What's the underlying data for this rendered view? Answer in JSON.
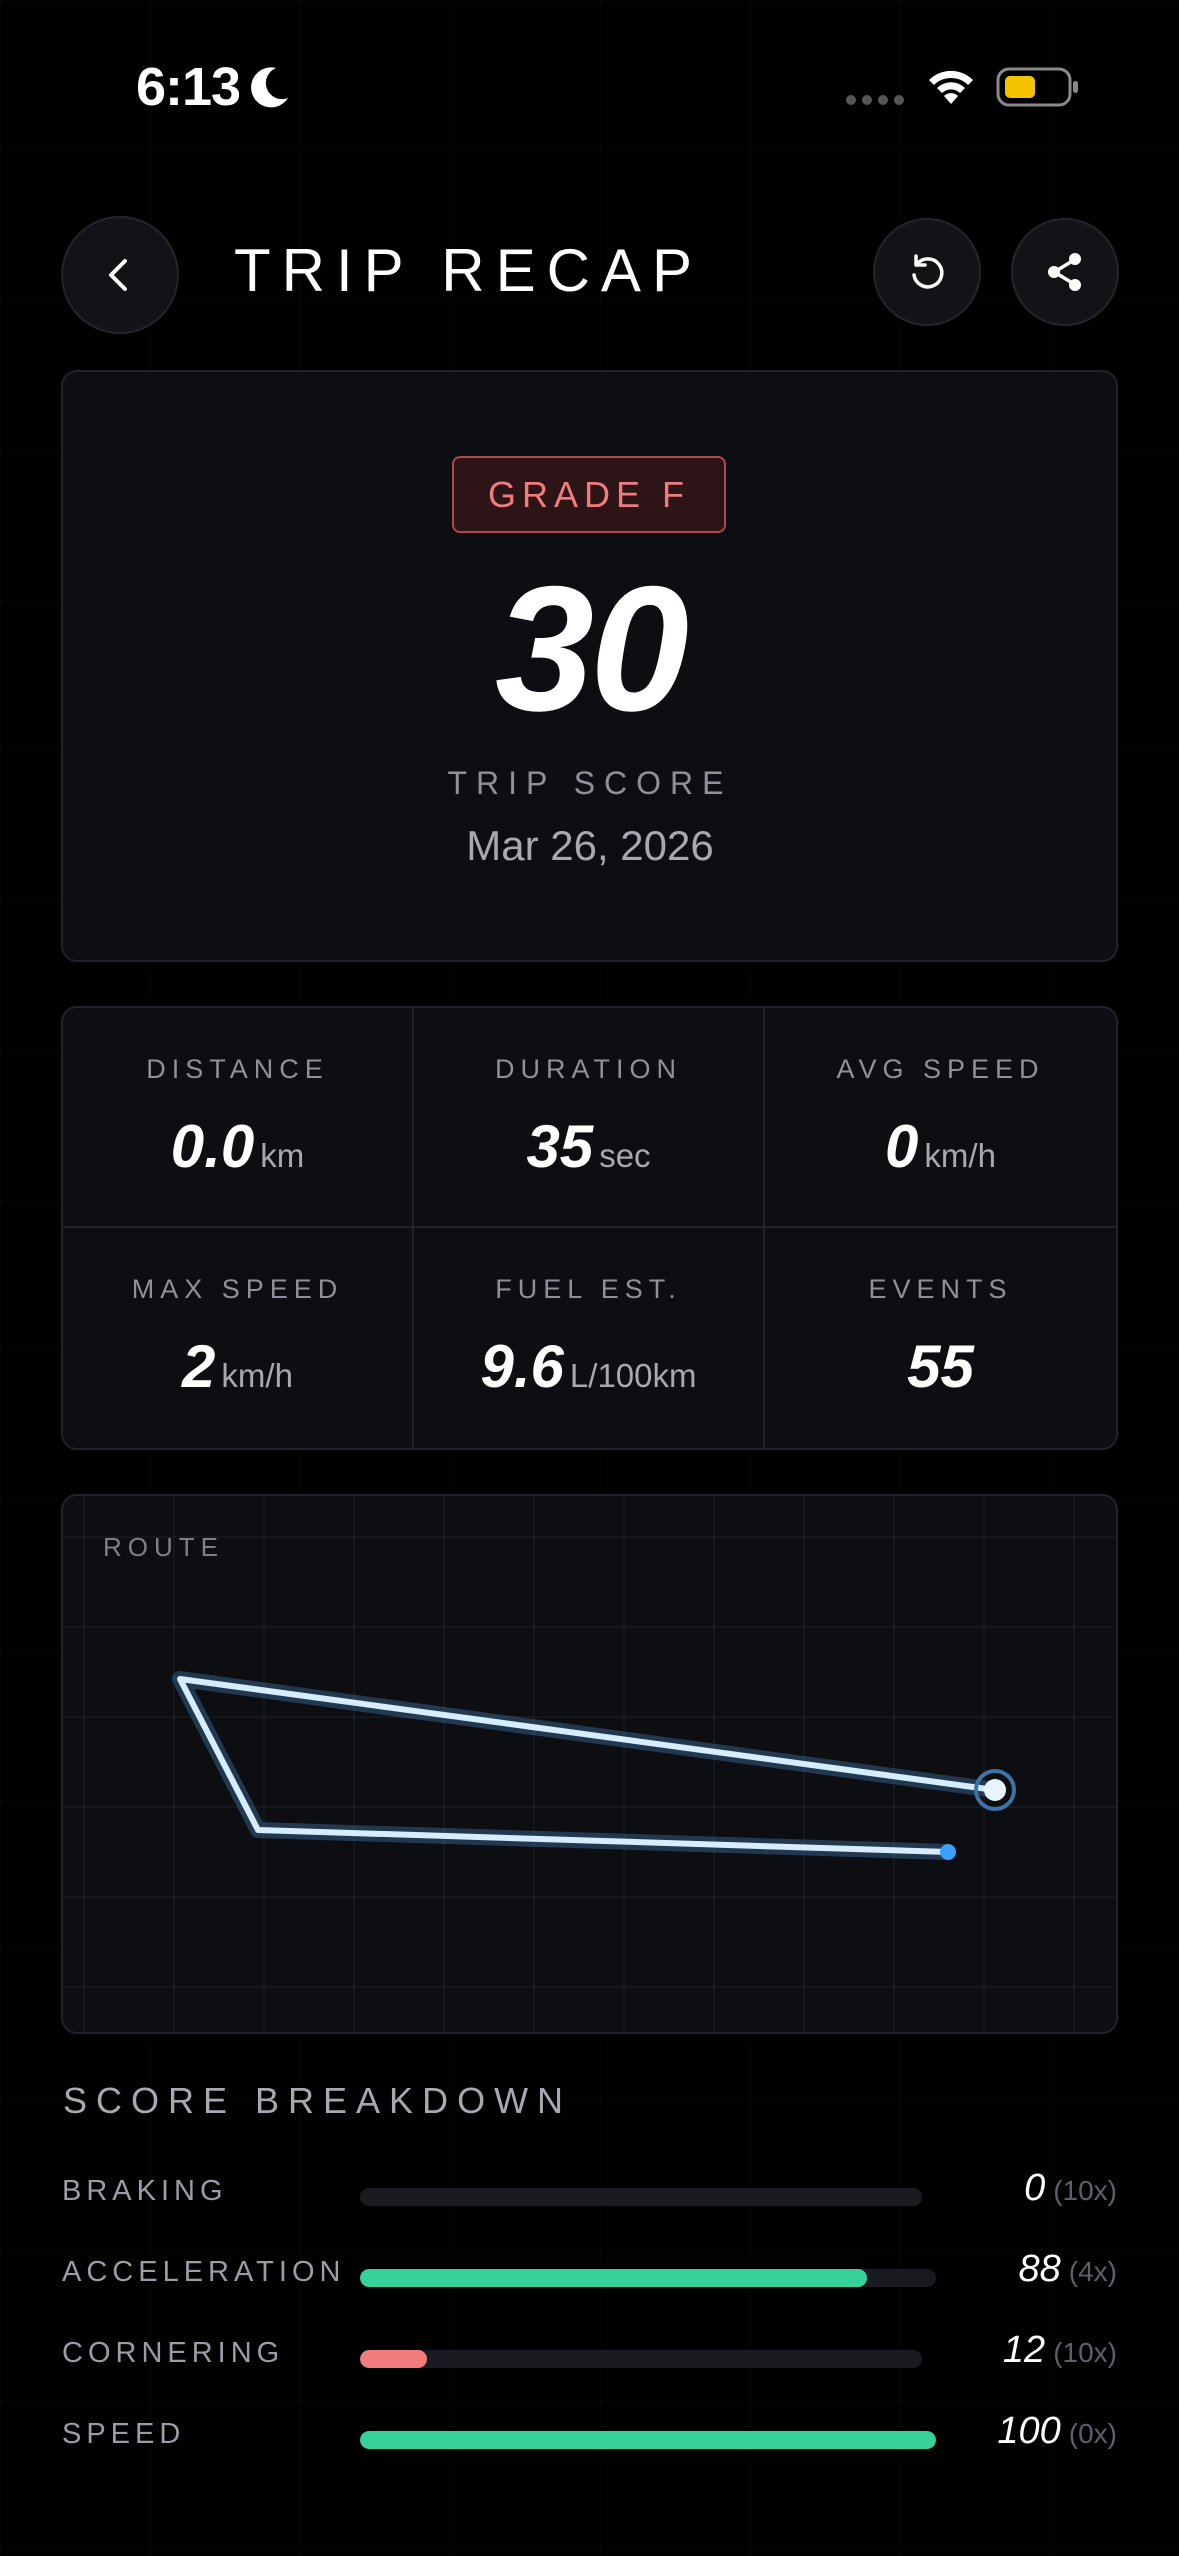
{
  "status_bar": {
    "time": "6:13",
    "battery_color": "#f5c400"
  },
  "header": {
    "title": "TRIP RECAP"
  },
  "score": {
    "grade": "GRADE F",
    "value": "30",
    "label": "TRIP SCORE",
    "date": "Mar 26, 2026"
  },
  "stats": [
    {
      "label": "DISTANCE",
      "value": "0.0",
      "unit": "km"
    },
    {
      "label": "DURATION",
      "value": "35",
      "unit": "sec"
    },
    {
      "label": "AVG SPEED",
      "value": "0",
      "unit": "km/h"
    },
    {
      "label": "MAX SPEED",
      "value": "2",
      "unit": "km/h"
    },
    {
      "label": "FUEL EST.",
      "value": "9.6",
      "unit": "L/100km"
    },
    {
      "label": "EVENTS",
      "value": "55",
      "unit": ""
    }
  ],
  "route": {
    "label": "ROUTE"
  },
  "breakdown": {
    "title": "SCORE BREAKDOWN",
    "items": [
      {
        "label": "BRAKING",
        "value": "0",
        "weight": "(10x)",
        "fill": 0.0,
        "color": "#35d39a"
      },
      {
        "label": "ACCELERATION",
        "value": "88",
        "weight": "(4x)",
        "fill": 0.88,
        "color": "#35d39a"
      },
      {
        "label": "CORNERING",
        "value": "12",
        "weight": "(10x)",
        "fill": 0.12,
        "color": "#f07c7e"
      },
      {
        "label": "SPEED",
        "value": "100",
        "weight": "(0x)",
        "fill": 1.0,
        "color": "#35d39a"
      }
    ]
  },
  "colors": {
    "accent_green": "#35d39a",
    "accent_red": "#f07c7e",
    "route_line": "#d6ecff",
    "route_end": "#3aa0ff"
  }
}
